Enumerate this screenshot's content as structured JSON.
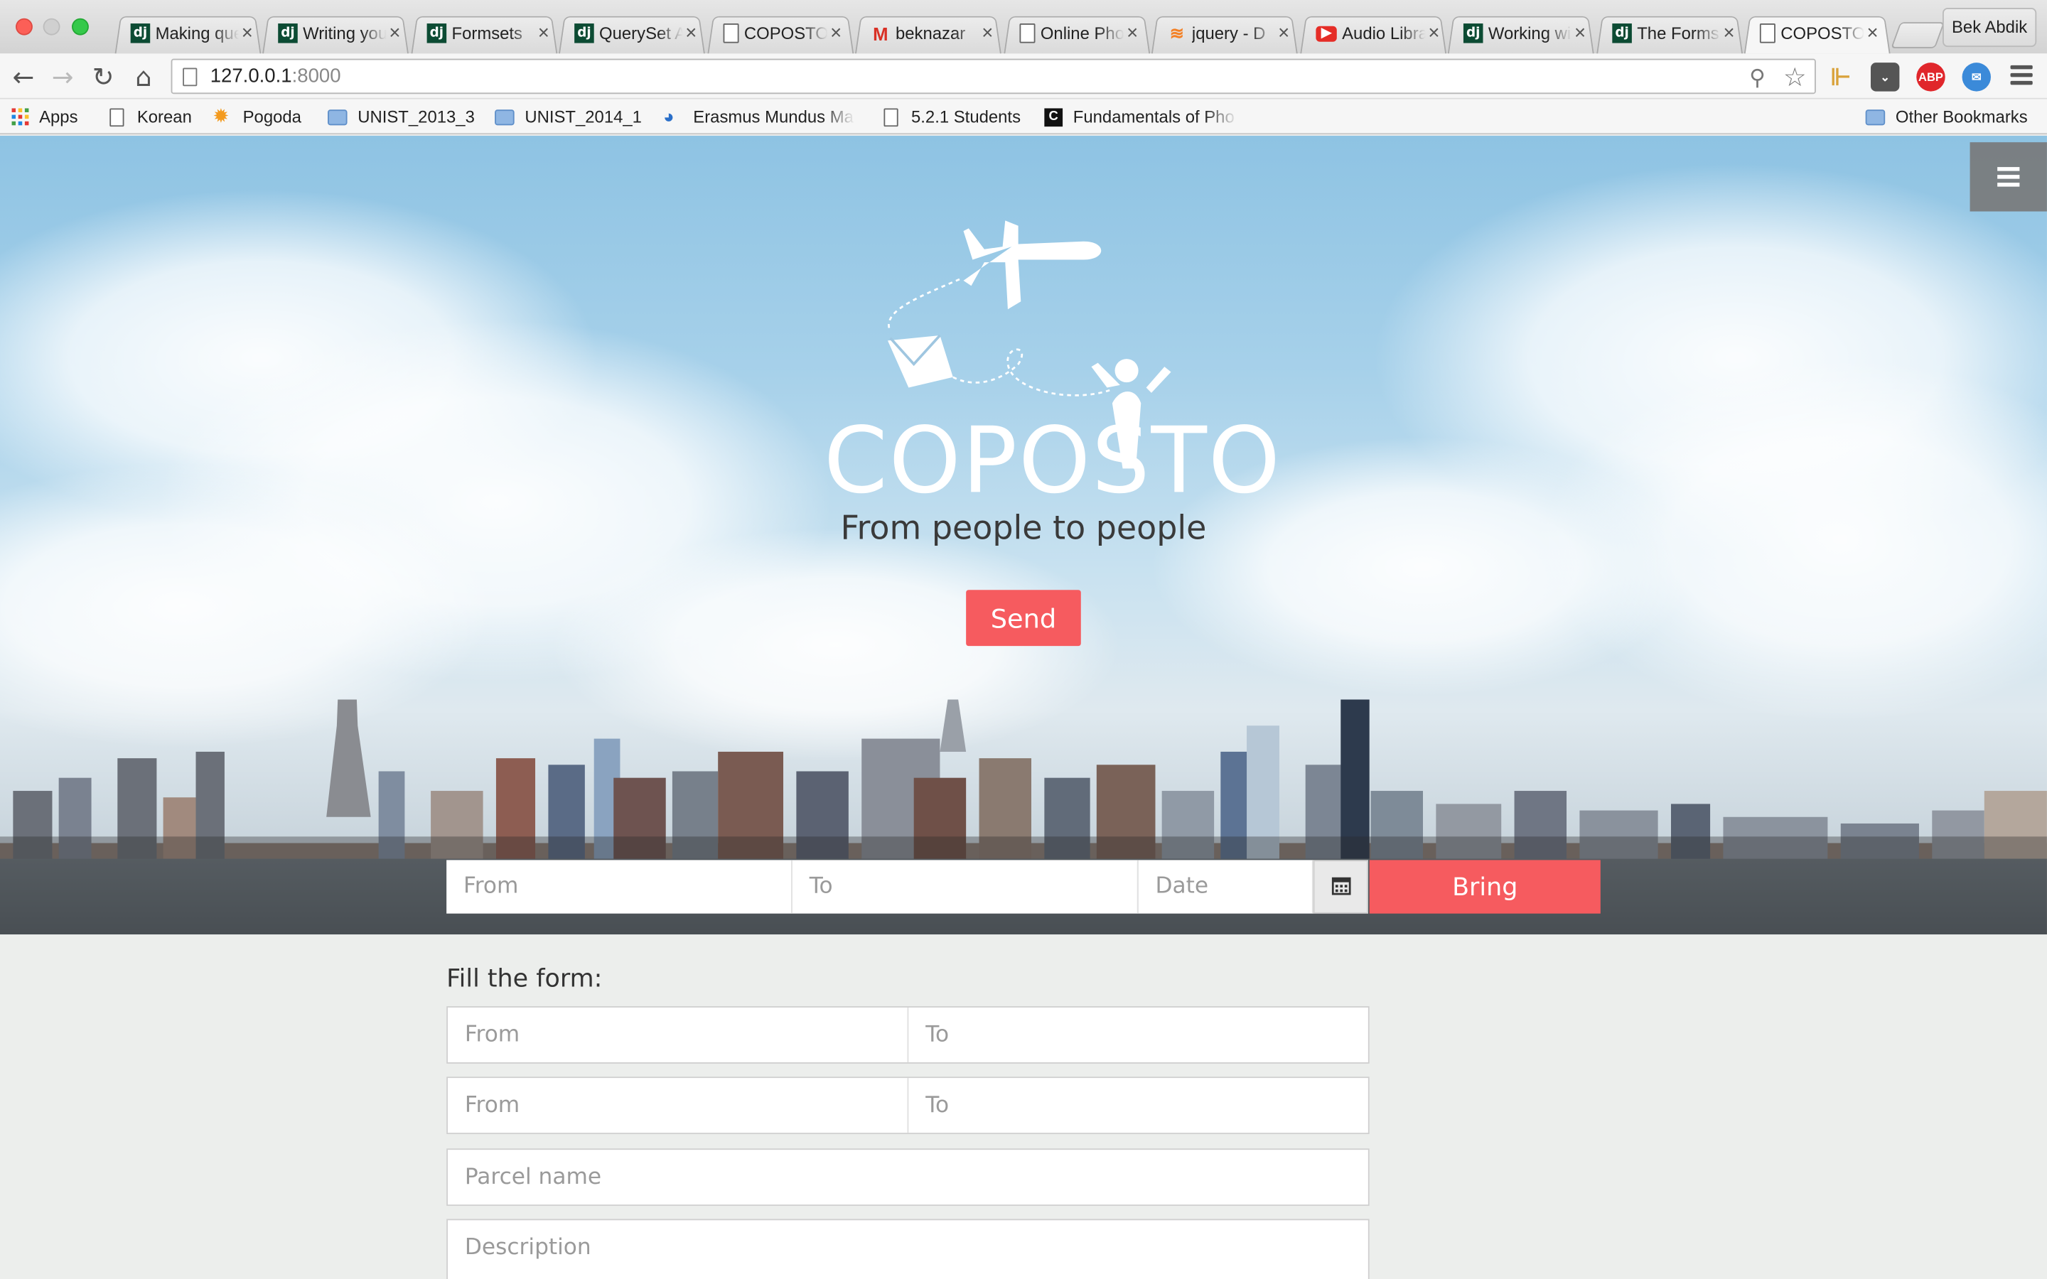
{
  "browser": {
    "tabs": [
      {
        "title": "Making queries",
        "favicon": "django-icon"
      },
      {
        "title": "Writing your",
        "favicon": "django-icon"
      },
      {
        "title": "Formsets",
        "favicon": "django-icon"
      },
      {
        "title": "QuerySet API",
        "favicon": "django-icon"
      },
      {
        "title": "COPOSTO",
        "favicon": "page-icon"
      },
      {
        "title": "beknazar",
        "favicon": "gmail-icon"
      },
      {
        "title": "Online Photo",
        "favicon": "page-icon"
      },
      {
        "title": "jquery - D",
        "favicon": "stackoverflow-icon"
      },
      {
        "title": "Audio Library",
        "favicon": "youtube-icon"
      },
      {
        "title": "Working with",
        "favicon": "django-icon"
      },
      {
        "title": "The Forms",
        "favicon": "django-icon"
      },
      {
        "title": "COPOSTO",
        "favicon": "page-icon",
        "active": true
      }
    ],
    "profile_name": "Bek Abdik",
    "url_host": "127.0.0.1",
    "url_port": ":8000",
    "extensions": [
      "ABP"
    ],
    "bookmarks": [
      {
        "label": "Apps",
        "icon": "apps-grid-icon"
      },
      {
        "label": "Korean",
        "icon": "page-icon"
      },
      {
        "label": "Pogoda",
        "icon": "sun-icon"
      },
      {
        "label": "UNIST_2013_3",
        "icon": "folder-icon"
      },
      {
        "label": "UNIST_2014_1",
        "icon": "folder-icon"
      },
      {
        "label": "Erasmus Mundus Ma",
        "icon": "globe-icon"
      },
      {
        "label": "5.2.1 Students",
        "icon": "page-icon"
      },
      {
        "label": "Fundamentals of Pho",
        "icon": "c-icon"
      }
    ],
    "other_bookmarks": "Other Bookmarks"
  },
  "hero": {
    "brand": "COPOSTO",
    "tagline": "From people to people",
    "send_label": "Send",
    "search": {
      "from_placeholder": "From",
      "to_placeholder": "To",
      "date_placeholder": "Date",
      "bring_label": "Bring"
    }
  },
  "form": {
    "title": "Fill the form:",
    "rows": [
      {
        "left": "From",
        "right": "To"
      },
      {
        "left": "From",
        "right": "To"
      }
    ],
    "parcel_placeholder": "Parcel name",
    "description_placeholder": "Description"
  },
  "colors": {
    "accent": "#f65b5f",
    "page_bg": "#eceeec"
  }
}
